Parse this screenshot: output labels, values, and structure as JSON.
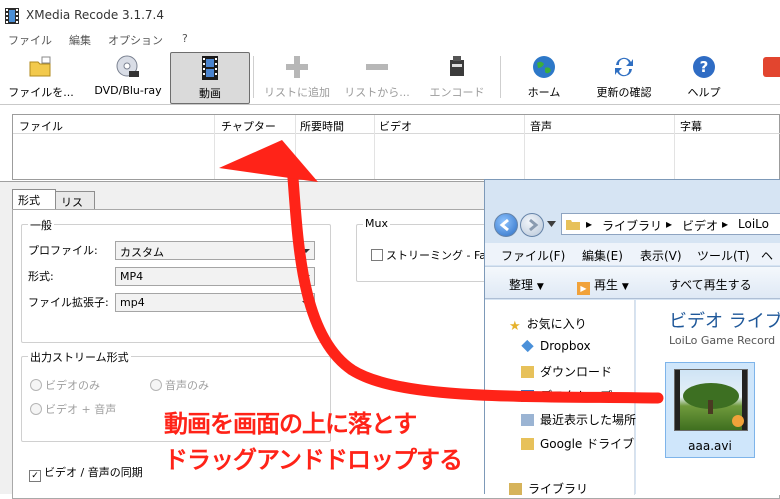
{
  "window": {
    "title": "XMedia Recode 3.1.7.4"
  },
  "menu": [
    "ファイル",
    "編集",
    "オプション",
    "?"
  ],
  "toolbar": {
    "open": "ファイルを...",
    "dvd": "DVD/Blu-ray",
    "video": "動画",
    "add_list": "リストに追加",
    "remove_list": "リストから...",
    "encode": "エンコード",
    "home": "ホーム",
    "update": "更新の確認",
    "help": "ヘルプ"
  },
  "file_table": {
    "columns": [
      "ファイル",
      "チャプター",
      "所要時間",
      "ビデオ",
      "音声",
      "字幕"
    ]
  },
  "tabs": [
    "形式",
    "リスト"
  ],
  "general": {
    "title": "一般",
    "profile_label": "プロファイル:",
    "profile_value": "カスタム",
    "format_label": "形式:",
    "format_value": "MP4",
    "ext_label": "ファイル拡張子:",
    "ext_value": "mp4"
  },
  "output_stream": {
    "title": "出力ストリーム形式",
    "video_only": "ビデオのみ",
    "audio_only": "音声のみ",
    "video_audio": "ビデオ + 音声"
  },
  "sync": {
    "label": "ビデオ / 音声の同期",
    "checked": true
  },
  "mux": {
    "title": "Mux",
    "streaming": "ストリーミング - Fast S"
  },
  "explorer": {
    "breadcrumb": [
      "ライブラリ",
      "ビデオ",
      "LoiLo"
    ],
    "menu": [
      "ファイル(F)",
      "編集(E)",
      "表示(V)",
      "ツール(T)",
      "ヘ"
    ],
    "commands": {
      "organize": "整理",
      "play": "再生",
      "play_all": "すべて再生する"
    },
    "nav": {
      "favorites": "お気に入り",
      "dropbox": "Dropbox",
      "downloads": "ダウンロード",
      "desktop": "デスクトップ",
      "recent": "最近表示した場所",
      "google_drive": "Google ドライブ",
      "libraries": "ライブラリ"
    },
    "library_title": "ビデオ ライブ",
    "library_subtitle": "LoiLo Game Record",
    "file_name": "aaa.avi"
  },
  "annotation": {
    "line1": "動画を画面の上に落とす",
    "line2": "ドラッグアンドドロップする",
    "color": "#ff2318"
  }
}
